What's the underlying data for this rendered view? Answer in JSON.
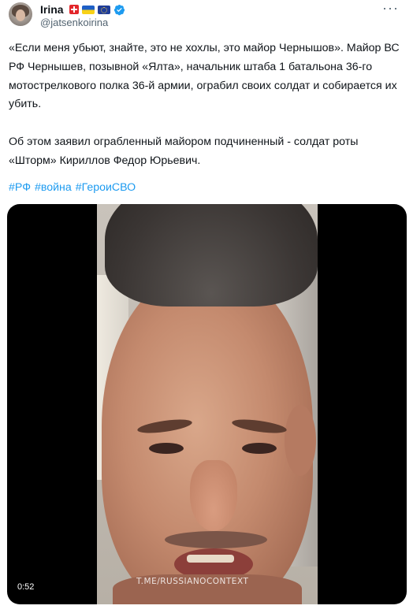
{
  "author": {
    "name": "Irina",
    "handle": "@jatsenkoirina",
    "badges": [
      "swiss-flag-icon",
      "ukraine-flag-icon",
      "eu-flag-icon",
      "verified-badge-icon"
    ]
  },
  "more_icon": "more-options-icon",
  "tweet": {
    "paragraph_1": "«Если меня убьют, знайте, это не хохлы, это майор Чернышов». Майор ВС РФ Чернышев, позывной «Ялта», начальник штаба 1 батальона 36-го мотострелкового полка 36-й армии, ограбил своих солдат и собирается их убить.",
    "paragraph_2": "Об этом заявил ограбленный майором подчиненный - солдат роты «Шторм» Кириллов Федор Юрьевич.",
    "hashtags": [
      "#РФ",
      "#война",
      "#ГероиСВО"
    ]
  },
  "media": {
    "watermark": "T.ME/RUSSIANOCONTEXT",
    "duration": "0:52"
  },
  "colors": {
    "link": "#1d9bf0",
    "text": "#0f1419",
    "secondary": "#536471",
    "verified": "#1d9bf0"
  }
}
